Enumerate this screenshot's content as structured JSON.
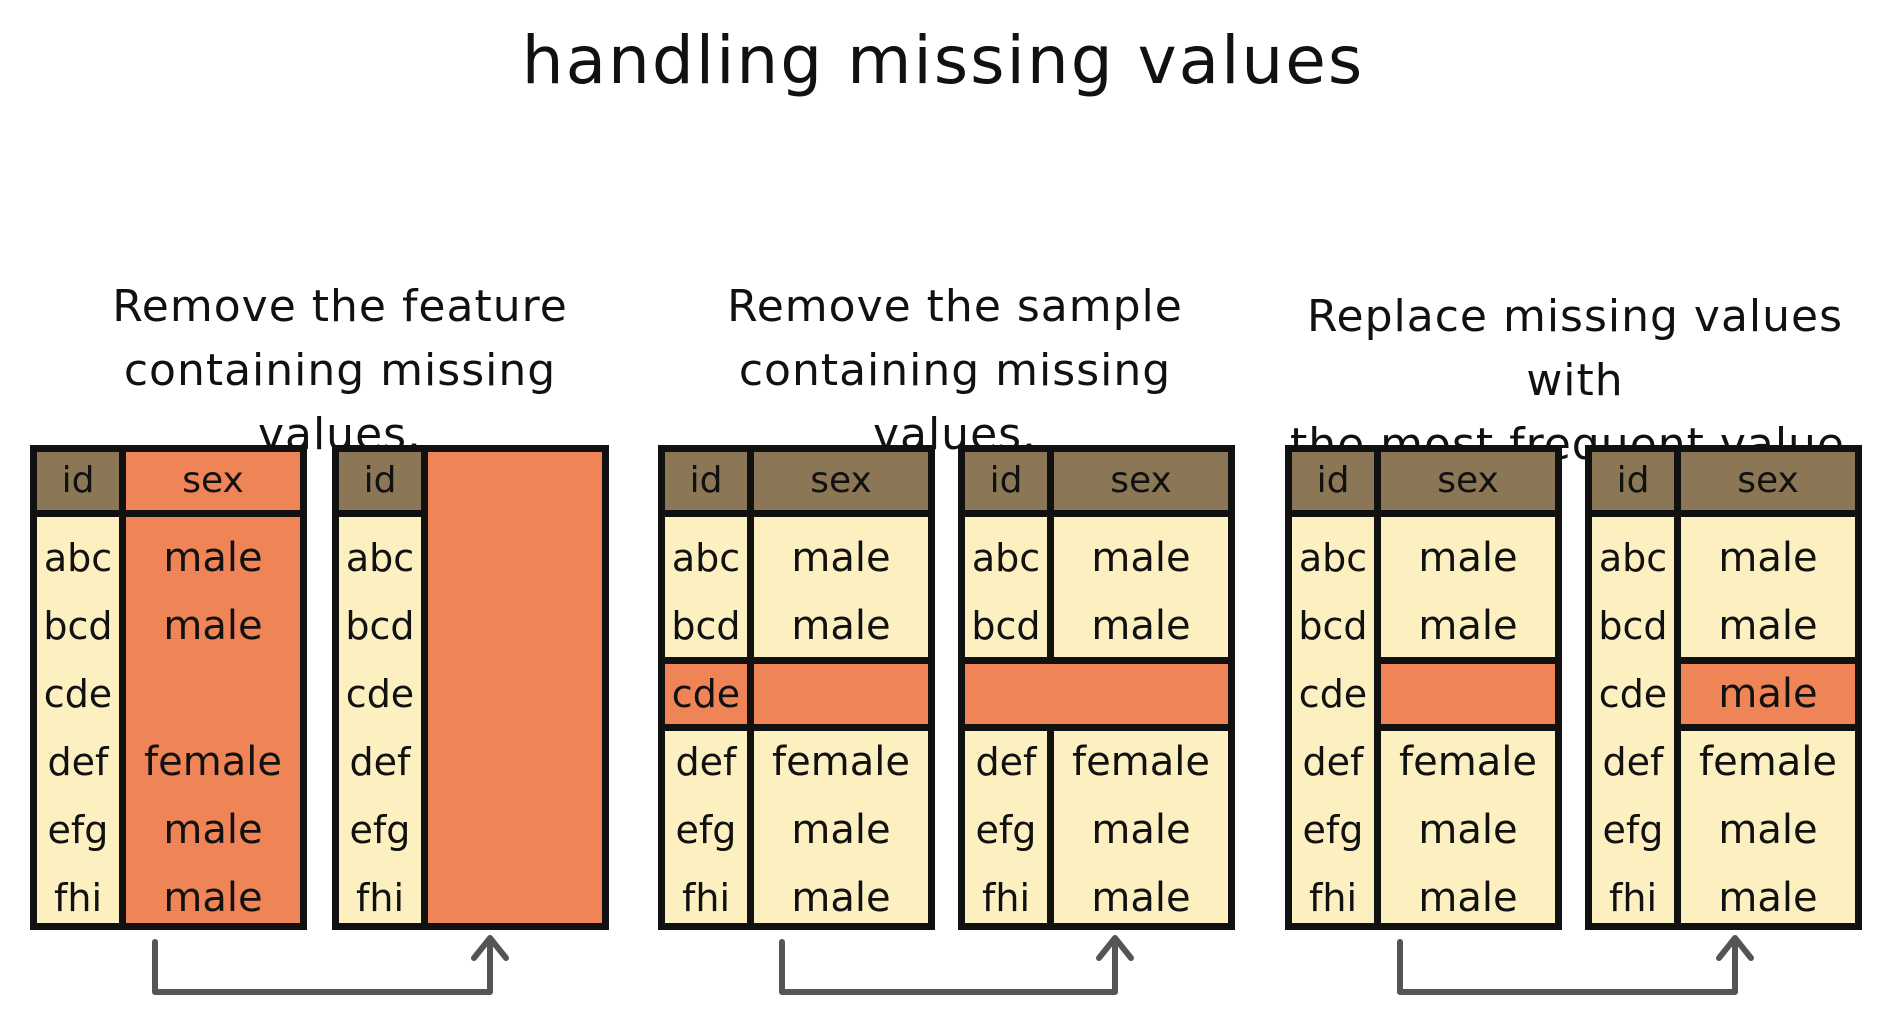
{
  "title": "handling missing values",
  "colors": {
    "header": "#8b7655",
    "cell": "#fdf0c0",
    "highlight": "#ef8556",
    "border": "#111111"
  },
  "sections": [
    {
      "caption_line1": "Remove the feature",
      "caption_line2": "containing missing values.",
      "before": {
        "headers": [
          "id",
          "sex"
        ],
        "rows": [
          [
            "abc",
            "male"
          ],
          [
            "bcd",
            "male"
          ],
          [
            "cde",
            ""
          ],
          [
            "def",
            "female"
          ],
          [
            "efg",
            "male"
          ],
          [
            "fhi",
            "male"
          ]
        ]
      },
      "after": {
        "headers": [
          "id",
          ""
        ],
        "rows": [
          [
            "abc",
            ""
          ],
          [
            "bcd",
            ""
          ],
          [
            "cde",
            ""
          ],
          [
            "def",
            ""
          ],
          [
            "efg",
            ""
          ],
          [
            "fhi",
            ""
          ]
        ]
      }
    },
    {
      "caption_line1": "Remove the sample",
      "caption_line2": "containing missing values.",
      "before": {
        "headers": [
          "id",
          "sex"
        ],
        "rows": [
          [
            "abc",
            "male"
          ],
          [
            "bcd",
            "male"
          ],
          [
            "cde",
            ""
          ],
          [
            "def",
            "female"
          ],
          [
            "efg",
            "male"
          ],
          [
            "fhi",
            "male"
          ]
        ]
      },
      "after": {
        "headers": [
          "id",
          "sex"
        ],
        "rows": [
          [
            "abc",
            "male"
          ],
          [
            "bcd",
            "male"
          ],
          [
            "",
            ""
          ],
          [
            "def",
            "female"
          ],
          [
            "efg",
            "male"
          ],
          [
            "fhi",
            "male"
          ]
        ]
      }
    },
    {
      "caption_line1": "Replace missing values with",
      "caption_line2": "the most frequent value.",
      "before": {
        "headers": [
          "id",
          "sex"
        ],
        "rows": [
          [
            "abc",
            "male"
          ],
          [
            "bcd",
            "male"
          ],
          [
            "cde",
            ""
          ],
          [
            "def",
            "female"
          ],
          [
            "efg",
            "male"
          ],
          [
            "fhi",
            "male"
          ]
        ]
      },
      "after": {
        "headers": [
          "id",
          "sex"
        ],
        "rows": [
          [
            "abc",
            "male"
          ],
          [
            "bcd",
            "male"
          ],
          [
            "cde",
            "male"
          ],
          [
            "def",
            "female"
          ],
          [
            "efg",
            "male"
          ],
          [
            "fhi",
            "male"
          ]
        ]
      }
    }
  ]
}
